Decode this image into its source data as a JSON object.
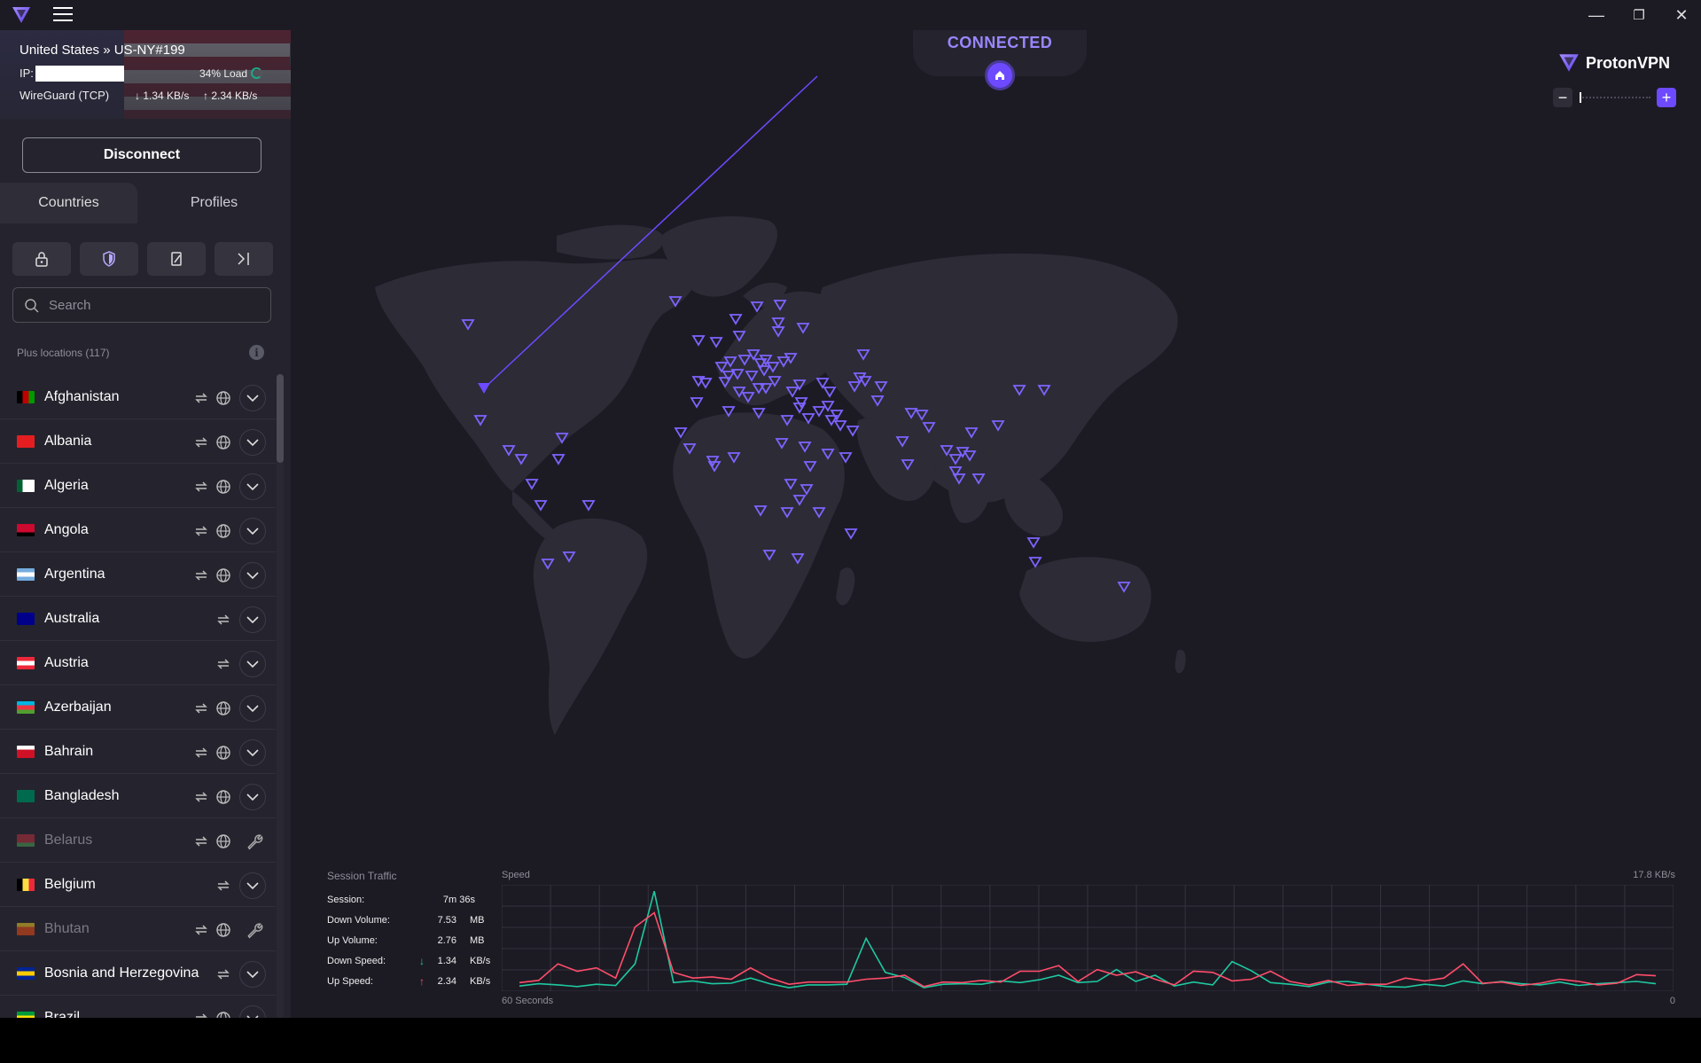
{
  "titlebar": {
    "minimize": "—",
    "maximize": "❐",
    "close": "✕"
  },
  "connection": {
    "server": "United States » US-NY#199",
    "ip_label": "IP:",
    "load": "34% Load",
    "load_fraction": 0.34,
    "protocol": "WireGuard (TCP)",
    "down_rate": "1.34 KB/s",
    "up_rate": "2.34 KB/s"
  },
  "disconnect_label": "Disconnect",
  "tabs": {
    "countries": "Countries",
    "profiles": "Profiles"
  },
  "search": {
    "placeholder": "Search"
  },
  "list_header": "Plus locations (117)",
  "countries": [
    {
      "name": "Afghanistan",
      "p2p": true,
      "tor": true,
      "state": "expand"
    },
    {
      "name": "Albania",
      "p2p": true,
      "tor": true,
      "state": "expand"
    },
    {
      "name": "Algeria",
      "p2p": true,
      "tor": true,
      "state": "expand"
    },
    {
      "name": "Angola",
      "p2p": true,
      "tor": true,
      "state": "expand"
    },
    {
      "name": "Argentina",
      "p2p": true,
      "tor": true,
      "state": "expand"
    },
    {
      "name": "Australia",
      "p2p": true,
      "tor": false,
      "state": "expand"
    },
    {
      "name": "Austria",
      "p2p": true,
      "tor": false,
      "state": "expand"
    },
    {
      "name": "Azerbaijan",
      "p2p": true,
      "tor": true,
      "state": "expand"
    },
    {
      "name": "Bahrain",
      "p2p": true,
      "tor": true,
      "state": "expand"
    },
    {
      "name": "Bangladesh",
      "p2p": true,
      "tor": true,
      "state": "expand"
    },
    {
      "name": "Belarus",
      "p2p": true,
      "tor": true,
      "state": "maintenance"
    },
    {
      "name": "Belgium",
      "p2p": true,
      "tor": false,
      "state": "expand"
    },
    {
      "name": "Bhutan",
      "p2p": true,
      "tor": true,
      "state": "maintenance"
    },
    {
      "name": "Bosnia and Herzegovina",
      "p2p": true,
      "tor": false,
      "state": "expand"
    },
    {
      "name": "Brazil",
      "p2p": true,
      "tor": true,
      "state": "expand"
    }
  ],
  "status": {
    "connected": "CONNECTED"
  },
  "brand": {
    "name": "ProtonVPN"
  },
  "traffic": {
    "title": "Session Traffic",
    "session_label": "Session:",
    "session_value": "7m 36s",
    "down_volume_label": "Down Volume:",
    "down_volume_value": "7.53",
    "down_volume_unit": "MB",
    "up_volume_label": "Up Volume:",
    "up_volume_value": "2.76",
    "up_volume_unit": "MB",
    "down_speed_label": "Down Speed:",
    "down_speed_value": "1.34",
    "down_speed_unit": "KB/s",
    "up_speed_label": "Up Speed:",
    "up_speed_value": "2.34",
    "up_speed_unit": "KB/s",
    "speed_label": "Speed",
    "max_label": "17.8 KB/s",
    "time_label": "60 Seconds",
    "zero_label": "0"
  },
  "chart_data": {
    "type": "line",
    "ylim": [
      0,
      17.8
    ],
    "series": [
      {
        "name": "Down Speed",
        "color": "#1ec9a0",
        "values": [
          0.6,
          1.0,
          0.8,
          0.5,
          0.9,
          0.7,
          4.5,
          17.3,
          1.2,
          1.5,
          1.0,
          1.1,
          2.0,
          1.0,
          0.3,
          0.8,
          0.8,
          0.9,
          9.0,
          3.0,
          2.1,
          0.3,
          0.9,
          1.0,
          0.9,
          1.5,
          1.2,
          1.7,
          2.5,
          1.2,
          1.4,
          3.5,
          1.4,
          2.5,
          0.6,
          1.3,
          0.8,
          4.9,
          3.3,
          1.2,
          0.9,
          0.5,
          1.3,
          1.4,
          0.9,
          0.5,
          0.4,
          0.9,
          0.6,
          1.5,
          1.0,
          1.4,
          1.0,
          0.8,
          1.3,
          0.7,
          1.0,
          1.2,
          1.4,
          1.0
        ]
      },
      {
        "name": "Up Speed",
        "color": "#ff4d6a",
        "values": [
          1.2,
          1.6,
          4.5,
          3.2,
          3.8,
          2.0,
          11.0,
          13.5,
          3.0,
          2.0,
          2.2,
          1.8,
          3.8,
          2.0,
          0.9,
          1.3,
          1.3,
          1.3,
          1.8,
          2.0,
          2.5,
          0.5,
          1.3,
          1.2,
          1.6,
          1.3,
          3.2,
          3.2,
          4.2,
          1.4,
          3.5,
          2.5,
          3.1,
          1.8,
          0.8,
          3.2,
          3.0,
          1.5,
          1.8,
          3.2,
          1.4,
          0.8,
          1.6,
          0.7,
          0.9,
          0.9,
          2.0,
          1.5,
          2.0,
          4.5,
          1.1,
          1.3,
          0.7,
          1.1,
          1.8,
          1.4,
          0.8,
          1.1,
          2.6,
          2.4
        ]
      }
    ]
  },
  "map": {
    "accent": "#6d4aff",
    "land_color": "#2c2b36"
  }
}
